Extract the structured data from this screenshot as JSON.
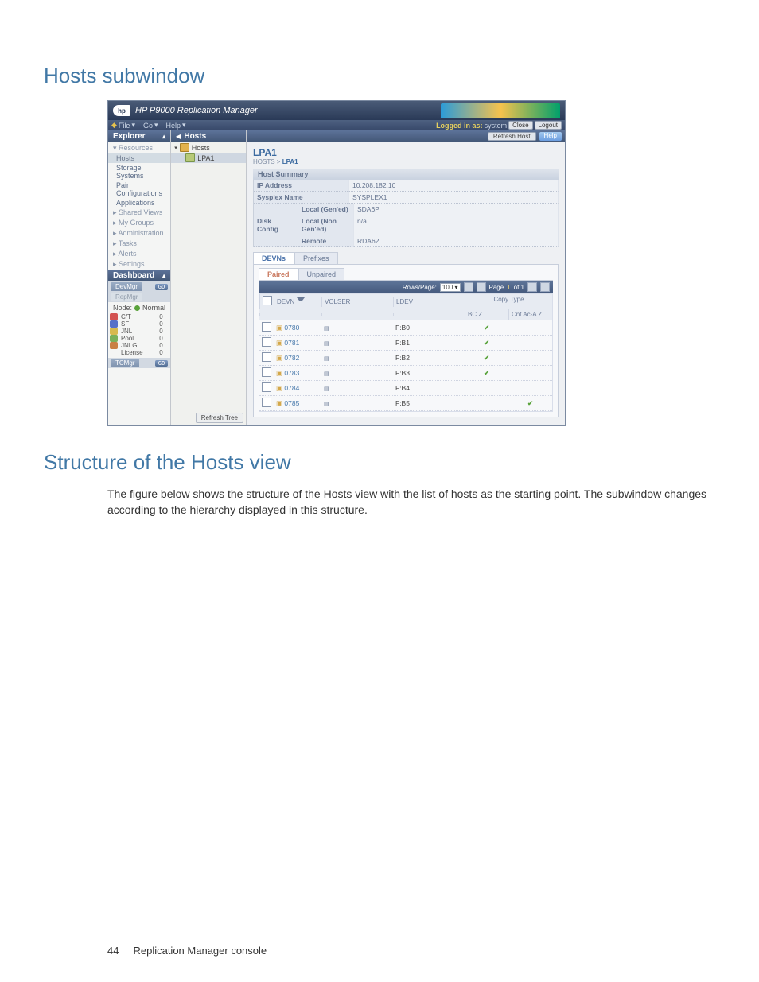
{
  "page": {
    "section_title": "Hosts subwindow",
    "section2_title": "Structure of the Hosts view",
    "para1": "The figure below shows the structure of the Hosts view with the list of hosts as the starting point. The subwindow changes according to the hierarchy displayed in this structure.",
    "footer_page": "44",
    "footer_label": "Replication Manager console"
  },
  "titlebar": {
    "product": "HP P9000 Replication Manager",
    "logo_text": "hp"
  },
  "menubar": {
    "items": [
      "File",
      "Go",
      "Help"
    ],
    "logged_in_label": "Logged in as:",
    "logged_in_user": "system",
    "btn_close": "Close",
    "btn_logout": "Logout"
  },
  "explorer": {
    "title": "Explorer",
    "sections": {
      "resources": "Resources",
      "hosts": "Hosts",
      "storage": "Storage Systems",
      "pairconf": "Pair Configurations",
      "apps": "Applications",
      "shared": "Shared Views",
      "mygrp": "My Groups",
      "admin": "Administration",
      "tasks": "Tasks",
      "alerts": "Alerts",
      "settings": "Settings"
    },
    "dashboard_title": "Dashboard",
    "dash_tabs": {
      "dev": "DevMgr",
      "rep": "RepMgr",
      "tc": "TCMgr"
    },
    "go": "GO",
    "node_label": "Node:",
    "node_value": "Normal",
    "grid": [
      {
        "color": "#d35251",
        "label": "C/T",
        "val": "0"
      },
      {
        "color": "#5770c9",
        "label": "SF",
        "val": "0"
      },
      {
        "color": "#d7b94f",
        "label": "JNL",
        "val": "0"
      },
      {
        "color": "#7ab05b",
        "label": "Pool",
        "val": "0"
      },
      {
        "color": "#c98044",
        "label": "JNLG",
        "val": "0"
      },
      {
        "color": "",
        "label": "License",
        "val": "0"
      }
    ]
  },
  "tree": {
    "title": "Hosts",
    "root": "Hosts",
    "child": "LPA1",
    "refresh": "Refresh Tree"
  },
  "main": {
    "btn_refresh_host": "Refresh Host",
    "btn_help": "Help",
    "title": "LPA1",
    "crumb_a": "HOSTS",
    "crumb_sep": ">",
    "crumb_b": "LPA1",
    "summary_label": "Host Summary",
    "ip_label": "IP Address",
    "ip_value": "10.208.182.10",
    "sysplex_label": "Sysplex Name",
    "sysplex_value": "SYSPLEX1",
    "disk_label": "Disk Config",
    "local_gened": "Local (Gen'ed)",
    "local_gened_val": "SDA6P",
    "local_nongened": "Local (Non Gen'ed)",
    "local_nongened_val": "n/a",
    "remote": "Remote",
    "remote_val": "RDA62",
    "tab_devns": "DEVNs",
    "tab_prefixes": "Prefixes",
    "subtab_paired": "Paired",
    "subtab_unpaired": "Unpaired",
    "pager_rows_label": "Rows/Page:",
    "pager_rows_value": "100",
    "pager_page_label": "Page",
    "pager_page_value": "1",
    "pager_of": "of 1",
    "cols": {
      "devn": "DEVN",
      "volser": "VOLSER",
      "ldev": "LDEV",
      "copy": "Copy Type",
      "bcz": "BC Z",
      "cntacaz": "Cnt Ac-A Z"
    },
    "rows": [
      {
        "devn": "0780",
        "ldev": "F:B0",
        "bcz": true,
        "cnt": false
      },
      {
        "devn": "0781",
        "ldev": "F:B1",
        "bcz": true,
        "cnt": false
      },
      {
        "devn": "0782",
        "ldev": "F:B2",
        "bcz": true,
        "cnt": false
      },
      {
        "devn": "0783",
        "ldev": "F:B3",
        "bcz": true,
        "cnt": false
      },
      {
        "devn": "0784",
        "ldev": "F:B4",
        "bcz": false,
        "cnt": false
      },
      {
        "devn": "0785",
        "ldev": "F:B5",
        "bcz": false,
        "cnt": true
      }
    ]
  }
}
